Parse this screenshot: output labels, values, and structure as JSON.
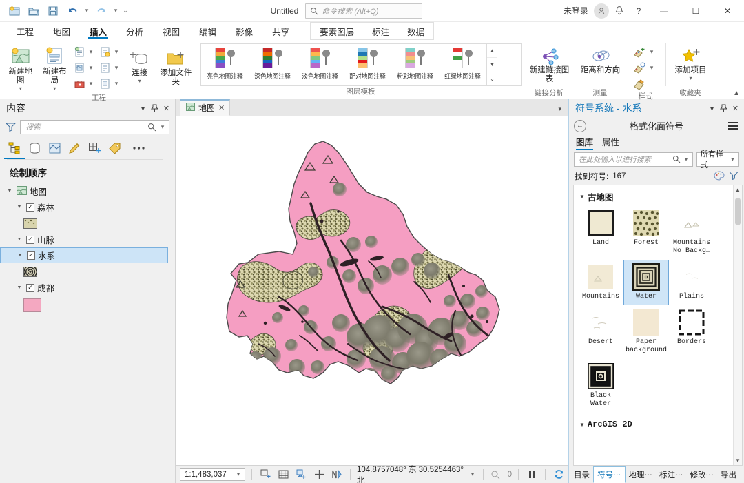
{
  "titlebar": {
    "doc_title": "Untitled",
    "command_search_placeholder": "命令搜索 (Alt+Q)",
    "sign_in": "未登录",
    "qat": [
      {
        "name": "new-project-icon",
        "glyph": "⊕"
      },
      {
        "name": "open-project-icon",
        "glyph": "☰"
      },
      {
        "name": "save-project-icon",
        "glyph": "⬚"
      },
      {
        "name": "undo-icon",
        "glyph": "↶"
      },
      {
        "name": "redo-icon",
        "glyph": "↷"
      },
      {
        "name": "customize-qat-icon",
        "glyph": "⌄"
      }
    ],
    "window_buttons": {
      "minimize": "—",
      "maximize": "☐",
      "close": "✕"
    },
    "help": "?",
    "notifications": "🔔"
  },
  "ribbon": {
    "tabs": [
      {
        "label": "工程",
        "active": false
      },
      {
        "label": "地图",
        "active": false
      },
      {
        "label": "插入",
        "active": true
      },
      {
        "label": "分析",
        "active": false
      },
      {
        "label": "视图",
        "active": false
      },
      {
        "label": "编辑",
        "active": false
      },
      {
        "label": "影像",
        "active": false
      },
      {
        "label": "共享",
        "active": false
      }
    ],
    "contextual_tabs": [
      {
        "label": "要素图层",
        "active": false
      },
      {
        "label": "标注",
        "active": false
      },
      {
        "label": "数据",
        "active": false
      }
    ],
    "groups": [
      {
        "label": "工程",
        "big_buttons": [
          {
            "label": "新建地图",
            "icon": "new-map-icon",
            "has_dropdown": true
          },
          {
            "label": "新建布局",
            "icon": "new-layout-icon",
            "has_dropdown": true
          }
        ],
        "small_buttons": [
          {
            "icon": "new-report-icon",
            "has_dropdown": true
          },
          {
            "icon": "import-map-icon",
            "has_dropdown": true
          },
          {
            "icon": "task-icon",
            "has_dropdown": true
          },
          {
            "icon": "add-notebook-icon",
            "has_dropdown": true
          },
          {
            "icon": "toolbox-icon",
            "has_dropdown": true
          },
          {
            "icon": "add-form-icon",
            "has_dropdown": true
          }
        ],
        "extra_buttons": [
          {
            "label": "连接",
            "icon": "connections-icon",
            "has_dropdown": true
          },
          {
            "label": "添加文件夹",
            "icon": "add-folder-icon",
            "has_dropdown": false
          }
        ]
      }
    ],
    "gallery": {
      "group_label": "图层模板",
      "items": [
        {
          "label": "亮色地图注释",
          "colors": [
            "#e8433c",
            "#f2a93b",
            "#4aa94a",
            "#3b7dd8",
            "#8a4fc4"
          ]
        },
        {
          "label": "深色地图注释",
          "colors": [
            "#c62828",
            "#ef6c00",
            "#2e7d32",
            "#1565c0",
            "#6a1b9a"
          ]
        },
        {
          "label": "淡色地图注释",
          "colors": [
            "#ef5350",
            "#ffb74d",
            "#81c784",
            "#64b5f6",
            "#ba68c8"
          ]
        },
        {
          "label": "配对地图注释",
          "colors": [
            "#86c5e8",
            "#1f78b4",
            "#b2df8a",
            "#e31a1c",
            "#fdbf6f"
          ]
        },
        {
          "label": "粉彩地图注释",
          "colors": [
            "#7fd1c9",
            "#f28e8e",
            "#f6c177",
            "#9ecb7d",
            "#d9a8e0"
          ]
        },
        {
          "label": "红绿地图注释",
          "colors": [
            "#e53935",
            "#ffffff",
            "#43a047",
            "#ffffff",
            "#e53935"
          ]
        }
      ]
    },
    "groups_right": [
      {
        "label": "链接分析",
        "buttons": [
          {
            "label": "新建链接图表",
            "icon": "link-chart-icon"
          }
        ]
      },
      {
        "label": "测量",
        "buttons": [
          {
            "label": "距离和方向",
            "icon": "distance-direction-icon"
          }
        ]
      },
      {
        "label": "样式",
        "buttons": [
          {
            "icon": "new-style-icon",
            "has_dropdown": true
          },
          {
            "icon": "add-style-icon",
            "has_dropdown": true
          },
          {
            "icon": "manage-styles-icon",
            "has_dropdown": false
          }
        ]
      },
      {
        "label": "收藏夹",
        "buttons": [
          {
            "label": "添加项目",
            "icon": "add-favorite-icon",
            "has_dropdown": true
          }
        ]
      }
    ],
    "collapse_icon": "chevron-up-icon"
  },
  "contents_pane": {
    "title": "内容",
    "header_buttons": [
      "menu-chevron-icon",
      "pin-icon",
      "close-icon"
    ],
    "search_placeholder": "搜索",
    "toolbar_icons": [
      {
        "name": "list-by-drawing-order-icon",
        "active": true
      },
      {
        "name": "list-by-data-source-icon",
        "active": false
      },
      {
        "name": "list-by-selection-icon",
        "active": false
      },
      {
        "name": "list-by-editing-icon",
        "active": false
      },
      {
        "name": "list-by-snapping-icon",
        "active": false
      },
      {
        "name": "list-by-labeling-icon",
        "active": false
      },
      {
        "name": "more-options-icon",
        "active": false
      }
    ],
    "heading": "绘制顺序",
    "map_node": {
      "label": "地图"
    },
    "layers": [
      {
        "label": "森林",
        "checked": true,
        "selected": false,
        "symbol": "forest-pattern",
        "symbol_color": "#8d8b5c"
      },
      {
        "label": "山脉",
        "checked": true,
        "selected": false,
        "symbol": null,
        "symbol_color": null
      },
      {
        "label": "水系",
        "checked": true,
        "selected": true,
        "symbol": "water-pattern",
        "symbol_color": "#4a4a44"
      },
      {
        "label": "成都",
        "checked": true,
        "selected": false,
        "symbol": "solid-fill",
        "symbol_color": "#f3a8c0"
      }
    ]
  },
  "map_view": {
    "tab_label": "地图",
    "tab_close_icon": "close-icon",
    "tab_dropdown_icon": "chevron-down-icon",
    "colors": {
      "polygon_fill": "#f59ec2",
      "polygon_outline": "#4a4a4a",
      "forest": "#b6b183",
      "mountain": "#7d7c70",
      "water": "#3a2a2e",
      "background": "#ffffff"
    }
  },
  "statusbar": {
    "scale": "1:1,483,037",
    "scale_dropdown_icon": "chevron-down-icon",
    "tools": [
      "select-tool-icon",
      "grid-icon",
      "layers-tool-icon",
      "pointer-icon",
      "navigate-icon"
    ],
    "coordinates": "104.8757048° 东  30.5254463° 北",
    "coords_dropdown_icon": "chevron-down-icon",
    "selection_count": "0",
    "pause_icon": "pause-icon",
    "refresh_icon": "refresh-icon"
  },
  "symbology_pane": {
    "title": "符号系统 - 水系",
    "header_buttons": [
      "menu-chevron-icon",
      "pin-icon",
      "close-icon"
    ],
    "back_icon": "back-arrow-icon",
    "subtitle": "格式化面符号",
    "menu_icon": "hamburger-icon",
    "tabs": [
      {
        "label": "图库",
        "active": true
      },
      {
        "label": "属性",
        "active": false
      }
    ],
    "search_placeholder": "在此处输入以进行搜索",
    "style_filter": "所有样式",
    "found_label": "找到符号:",
    "found_count": "167",
    "found_icons": [
      "palette-icon",
      "filter-icon"
    ],
    "groups": [
      {
        "name": "古地图",
        "expanded": true,
        "items": [
          {
            "label": "Land",
            "thumb": "land",
            "selected": false
          },
          {
            "label": "Forest",
            "thumb": "forest",
            "selected": false
          },
          {
            "label": "Mountains No Backg…",
            "thumb": "mountains-nobg",
            "selected": false
          },
          {
            "label": "Mountains",
            "thumb": "mountains",
            "selected": false
          },
          {
            "label": "Water",
            "thumb": "water",
            "selected": true
          },
          {
            "label": "Plains",
            "thumb": "plains",
            "selected": false
          },
          {
            "label": "Desert",
            "thumb": "desert",
            "selected": false
          },
          {
            "label": "Paper background",
            "thumb": "paper",
            "selected": false
          },
          {
            "label": "Borders",
            "thumb": "borders",
            "selected": false
          },
          {
            "label": "Black Water",
            "thumb": "black-water",
            "selected": false
          }
        ]
      },
      {
        "name": "ArcGIS 2D",
        "expanded": true,
        "items": []
      }
    ],
    "bottom_tabs": [
      {
        "label": "目录",
        "active": false
      },
      {
        "label": "符号⋯",
        "active": true
      },
      {
        "label": "地理⋯",
        "active": false
      },
      {
        "label": "标注⋯",
        "active": false
      },
      {
        "label": "修改⋯",
        "active": false
      },
      {
        "label": "导出",
        "active": false
      }
    ]
  }
}
